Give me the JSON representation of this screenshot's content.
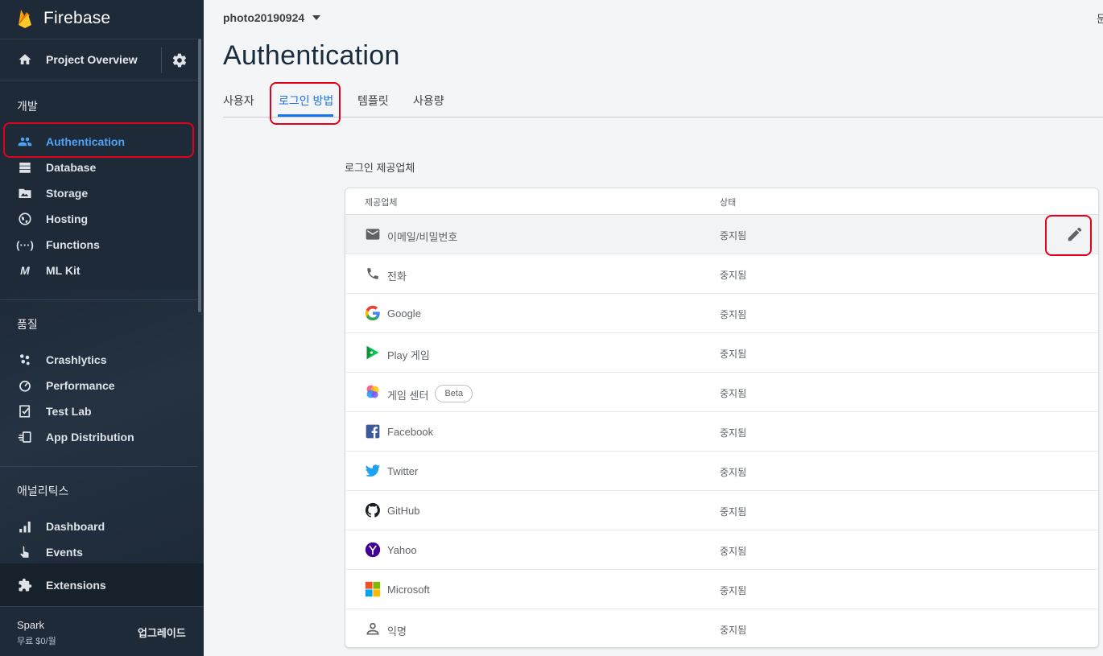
{
  "brand": {
    "name": "Firebase"
  },
  "sidebar": {
    "project_overview": "Project Overview",
    "sections": {
      "develop": "개발",
      "quality": "품질",
      "analytics": "애널리틱스"
    },
    "develop_items": [
      {
        "label": "Authentication",
        "icon": "people-icon"
      },
      {
        "label": "Database",
        "icon": "database-icon"
      },
      {
        "label": "Storage",
        "icon": "storage-icon"
      },
      {
        "label": "Hosting",
        "icon": "globe-icon"
      },
      {
        "label": "Functions",
        "icon": "functions-icon"
      },
      {
        "label": "ML Kit",
        "icon": "mlkit-icon"
      }
    ],
    "quality_items": [
      {
        "label": "Crashlytics",
        "icon": "crashlytics-icon"
      },
      {
        "label": "Performance",
        "icon": "performance-icon"
      },
      {
        "label": "Test Lab",
        "icon": "test-lab-icon"
      },
      {
        "label": "App Distribution",
        "icon": "app-distribution-icon"
      }
    ],
    "analytics_items": [
      {
        "label": "Dashboard",
        "icon": "bar-chart-icon"
      },
      {
        "label": "Events",
        "icon": "touch-icon"
      }
    ],
    "extensions": "Extensions",
    "plan": {
      "name": "Spark",
      "price": "무료 $0/월",
      "upgrade": "업그레이드"
    }
  },
  "header": {
    "project": "photo20190924",
    "top_right": "문",
    "title": "Authentication"
  },
  "tabs": [
    {
      "label": "사용자"
    },
    {
      "label": "로그인 방법",
      "active": true
    },
    {
      "label": "템플릿"
    },
    {
      "label": "사용량"
    }
  ],
  "providers": {
    "title": "로그인 제공업체",
    "columns": {
      "provider": "제공업체",
      "status": "상태"
    },
    "rows": [
      {
        "name": "이메일/비밀번호",
        "status": "중지됨",
        "icon": "email-icon"
      },
      {
        "name": "전화",
        "status": "중지됨",
        "icon": "phone-icon"
      },
      {
        "name": "Google",
        "status": "중지됨",
        "icon": "google-icon"
      },
      {
        "name": "Play 게임",
        "status": "중지됨",
        "icon": "play-games-icon"
      },
      {
        "name": "게임 센터",
        "status": "중지됨",
        "icon": "game-center-icon",
        "badge": "Beta"
      },
      {
        "name": "Facebook",
        "status": "중지됨",
        "icon": "facebook-icon"
      },
      {
        "name": "Twitter",
        "status": "중지됨",
        "icon": "twitter-icon"
      },
      {
        "name": "GitHub",
        "status": "중지됨",
        "icon": "github-icon"
      },
      {
        "name": "Yahoo",
        "status": "중지됨",
        "icon": "yahoo-icon"
      },
      {
        "name": "Microsoft",
        "status": "중지됨",
        "icon": "microsoft-icon"
      },
      {
        "name": "익명",
        "status": "중지됨",
        "icon": "anonymous-icon"
      }
    ]
  },
  "colors": {
    "sidebar_bg": "#1e2a38",
    "accent": "#1a73e8",
    "active_nav": "#4fa3f7",
    "highlight_outline": "#e3001b"
  }
}
